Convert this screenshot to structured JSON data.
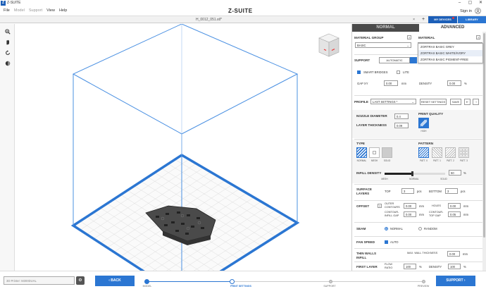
{
  "app": {
    "logo": "Z",
    "title": "Z-SUITE",
    "brand": "Z-SUITE"
  },
  "window_controls": {
    "minimize": "–",
    "maximize": "▢",
    "close": "✕"
  },
  "menu": [
    "File",
    "Model",
    "Support",
    "View",
    "Help"
  ],
  "account": {
    "sign_in": "Sign in",
    "avatar_icon": "user-icon"
  },
  "tabs": {
    "file_tab": "H_0012_051.stl*",
    "close": "×",
    "add": "+",
    "my_devices": "MY DEVICES",
    "library": "LIBRARY"
  },
  "left_tools": [
    "zoom-icon",
    "pan-icon",
    "rotate-icon",
    "view-icon"
  ],
  "panel": {
    "mode_tabs": {
      "normal": "NORMAL",
      "advanced": "ADVANCED"
    },
    "material_group": {
      "label": "MATERIAL GROUP",
      "value": "BASIC"
    },
    "material": {
      "label": "MATERIAL",
      "value": "ZORTRAX BASIC WHITE/IVORY",
      "options": [
        "ZORTRAX BASIC GREY",
        "ZORTRAX BASIC WHITE/IVORY",
        "ZORTRAX BASIC PIGMENT-FREE"
      ]
    },
    "support": {
      "label": "SUPPORT",
      "automatic": "AUTOMATIC",
      "smart_bridges": "SMART BRIDGES",
      "lite": "LITE",
      "gap_xy_label": "GAP XY",
      "gap_xy": "0.00",
      "gap_unit": "mm",
      "density_label": "DENSITY",
      "density": "0.00",
      "density_unit": "%"
    },
    "profile": {
      "label": "PROFILE",
      "value": "LAST SETTINGS *",
      "reset": "RESET SETTINGS",
      "save": "SAVE"
    },
    "nozzle": {
      "label": "NOZZLE DIAMETER",
      "value": "0.4"
    },
    "layer": {
      "label": "LAYER THICKNESS",
      "value": "0.09"
    },
    "print_quality": {
      "label": "PRINT QUALITY",
      "value": "HIGH"
    },
    "type": {
      "label": "TYPE",
      "options": [
        "NORMAL",
        "MESH",
        "SOLID"
      ]
    },
    "pattern": {
      "label": "PATTERN",
      "options": [
        "PATT. 0",
        "PATT. 1",
        "PATT. 2",
        "PATT. 3"
      ]
    },
    "infill": {
      "label": "INFILL DENSITY",
      "value": "50",
      "unit": "%",
      "level": 0.45,
      "marks": [
        "MESH",
        "NORMAL",
        "SOLID"
      ]
    },
    "surface": {
      "label1": "SURFACE",
      "label2": "LAYERS",
      "top_label": "TOP",
      "top": "3",
      "bottom_label": "BOTTOM",
      "bottom": "3",
      "unit": "pcs"
    },
    "offset": {
      "label": "OFFSET",
      "outer_label1": "OUTER",
      "outer_label2": "CONTOURS",
      "outer": "0.00",
      "holes_label": "HOLES",
      "holes": "0.00",
      "cig_label1": "CONTOUR-",
      "cig_label2": "INFILL GAP",
      "cig": "0.00",
      "ctg_label1": "CONTOUR-",
      "ctg_label2": "TOP GAP",
      "ctg": "0.05",
      "unit": "mm"
    },
    "seam": {
      "label": "SEAM",
      "normal": "NORMAL",
      "random": "RANDOM"
    },
    "fan": {
      "label": "FAN SPEED",
      "auto": "AUTO"
    },
    "thin_walls": {
      "label1": "THIN WALLS",
      "label2": "INFILL",
      "max_label": "MAX. WALL THICKNESS",
      "value": "0.00",
      "unit": "mm"
    },
    "first_layer": {
      "label": "FIRST LAYER",
      "flow_label1": "FLOW",
      "flow_label2": "RATIO",
      "flow": "100",
      "density_label": "DENSITY",
      "density": "100",
      "unit": "%"
    }
  },
  "bottom": {
    "printer_placeholder": "3D Printer: M300DUAL",
    "back": "BACK",
    "support_btn": "SUPPORT",
    "steps": [
      "MODEL",
      "PRINT SETTINGS",
      "SUPPORT",
      "PREVIEW",
      "EXPORT"
    ],
    "current_step": 1
  },
  "colors": {
    "accent": "#2b76d2",
    "brand": "#1c5fb8",
    "dark_tab": "#4a4a4a"
  }
}
